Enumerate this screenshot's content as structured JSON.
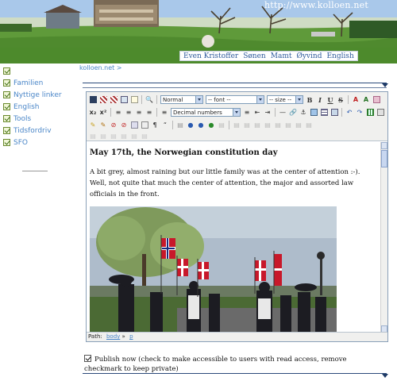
{
  "header": {
    "url": "http://www.kolloen.net",
    "nav": [
      "Even Kristoffer",
      "Sønen",
      "Mamt",
      "Øyvind",
      "English"
    ]
  },
  "sidebar": {
    "items": [
      {
        "label": ""
      },
      {
        "label": "Familien"
      },
      {
        "label": "Nyttige linker"
      },
      {
        "label": "English"
      },
      {
        "label": "Tools"
      },
      {
        "label": "Tidsfordriv"
      },
      {
        "label": "SFO"
      }
    ]
  },
  "breadcrumb": "kolloen.net >",
  "editor": {
    "toolbar": {
      "format": "Normal",
      "font": "-- font --",
      "size": "-- size --",
      "list": "Decimal numbers",
      "bold": "B",
      "italic": "I",
      "underline": "U",
      "strike": "S",
      "font_color": "A",
      "highlight": "A"
    },
    "heading": "May 17th, the Norwegian constitution day",
    "body": "A bit grey, almost raining but our little family was at the center of attention :-). Well, not quite that much the center of attention, the major and assorted law officials in the front.",
    "path_label": "Path:",
    "path_items": [
      "body",
      "p"
    ]
  },
  "publish": {
    "label": "Publish now (check to make accessible to users with read access, remove checkmark to keep private)",
    "checked": true
  },
  "colors": {
    "link": "#4a86c8",
    "rule": "#2b4a7a"
  }
}
